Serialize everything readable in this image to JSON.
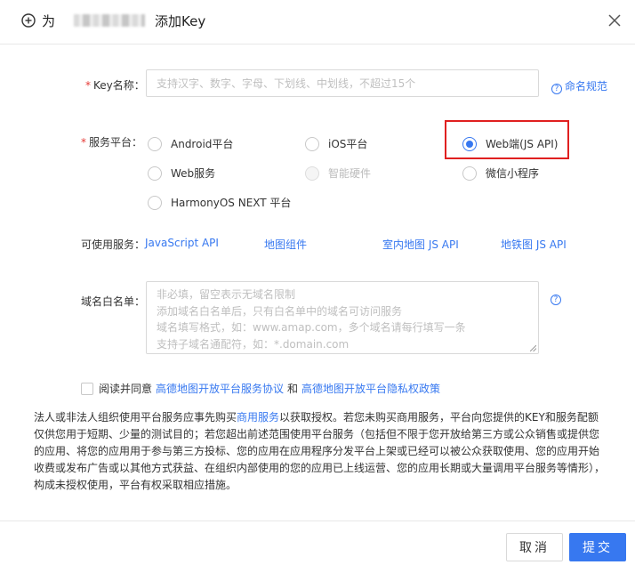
{
  "header": {
    "title_prefix": "为",
    "title_suffix": "添加Key"
  },
  "form": {
    "key_name": {
      "label": "Key名称：",
      "required_mark": "*",
      "value": "",
      "placeholder": "支持汉字、数字、字母、下划线、中划线，不超过15个",
      "help_link": "命名规范"
    },
    "platform": {
      "label": "服务平台：",
      "required_mark": "*",
      "options": [
        {
          "label": "Android平台",
          "checked": false,
          "disabled": false
        },
        {
          "label": "iOS平台",
          "checked": false,
          "disabled": false
        },
        {
          "label": "Web端(JS API)",
          "checked": true,
          "disabled": false
        },
        {
          "label": "Web服务",
          "checked": false,
          "disabled": false
        },
        {
          "label": "智能硬件",
          "checked": false,
          "disabled": true
        },
        {
          "label": "微信小程序",
          "checked": false,
          "disabled": false
        },
        {
          "label": "HarmonyOS NEXT 平台",
          "checked": false,
          "disabled": false
        }
      ]
    },
    "services": {
      "label": "可使用服务：",
      "items": [
        "JavaScript API",
        "地图组件",
        "室内地图 JS API",
        "地铁图 JS API"
      ]
    },
    "domain_whitelist": {
      "label": "域名白名单：",
      "placeholder_lines": [
        "非必填，留空表示无域名限制",
        "添加域名白名单后，只有白名单中的域名可访问服务",
        "域名填写格式，如：www.amap.com，多个域名请每行填写一条",
        "支持子域名通配符，如：*.domain.com"
      ],
      "help_mark": "?"
    },
    "agreement": {
      "prefix": "阅读并同意",
      "link1": "高德地图开放平台服务协议",
      "conjunction": "和",
      "link2": "高德地图开放平台隐私权政策",
      "checked": false
    }
  },
  "notice": {
    "part1": "法人或非法人组织使用平台服务应事先购买",
    "link": "商用服务",
    "part2": "以获取授权。若您未购买商用服务，平台向您提供的KEY和服务配额仅供您用于短期、少量的测试目的；若您超出前述范围使用平台服务（包括但不限于您开放给第三方或公众销售或提供您的应用、将您的应用用于参与第三方投标、您的应用在应用程序分发平台上架或已经可以被公众获取使用、您的应用开始收费或发布广告或以其他方式获益、在组织内部使用的您的应用已上线运营、您的应用长期或大量调用平台服务等情形），构成未授权使用，平台有权采取相应措施。"
  },
  "footer": {
    "cancel_label": "取消",
    "submit_label": "提交"
  },
  "colors": {
    "accent": "#3778f0",
    "required": "#e53935",
    "highlight": "#e02020"
  }
}
